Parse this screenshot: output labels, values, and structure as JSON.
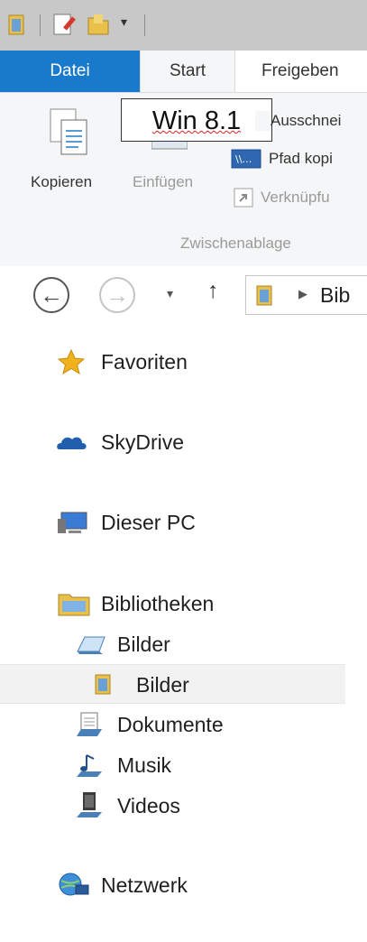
{
  "ribbon": {
    "tabs": {
      "file": "Datei",
      "start": "Start",
      "share": "Freigeben"
    },
    "annotation": "Win 8.1",
    "buttons": {
      "copy": "Kopieren",
      "paste": "Einfügen",
      "cut": "Ausschnei",
      "copy_path": "Pfad kopi",
      "paste_shortcut": "Verknüpfu"
    },
    "group_clipboard": "Zwischenablage"
  },
  "address": {
    "crumb": "Bib"
  },
  "nav": {
    "favorites": "Favoriten",
    "skydrive": "SkyDrive",
    "this_pc": "Dieser PC",
    "libraries": "Bibliotheken",
    "pictures": "Bilder",
    "pictures_sub": "Bilder",
    "documents": "Dokumente",
    "music": "Musik",
    "videos": "Videos",
    "network": "Netzwerk"
  },
  "colors": {
    "accent": "#1979ca",
    "ribbon_bg": "#f5f6f7",
    "titlebar": "#c8c8c8"
  },
  "icons": [
    "folder-icon",
    "properties-icon",
    "new-folder-icon",
    "qat-dropdown-icon",
    "copy-icon",
    "paste-icon",
    "scissors-icon",
    "copy-path-icon",
    "shortcut-icon",
    "back-icon",
    "forward-icon",
    "recent-dropdown-icon",
    "up-icon",
    "library-icon",
    "breadcrumb-arrow-icon",
    "star-icon",
    "cloud-icon",
    "computer-icon",
    "libraries-icon",
    "pictures-library-icon",
    "pictures-folder-icon",
    "documents-icon",
    "music-icon",
    "videos-icon",
    "network-icon"
  ]
}
